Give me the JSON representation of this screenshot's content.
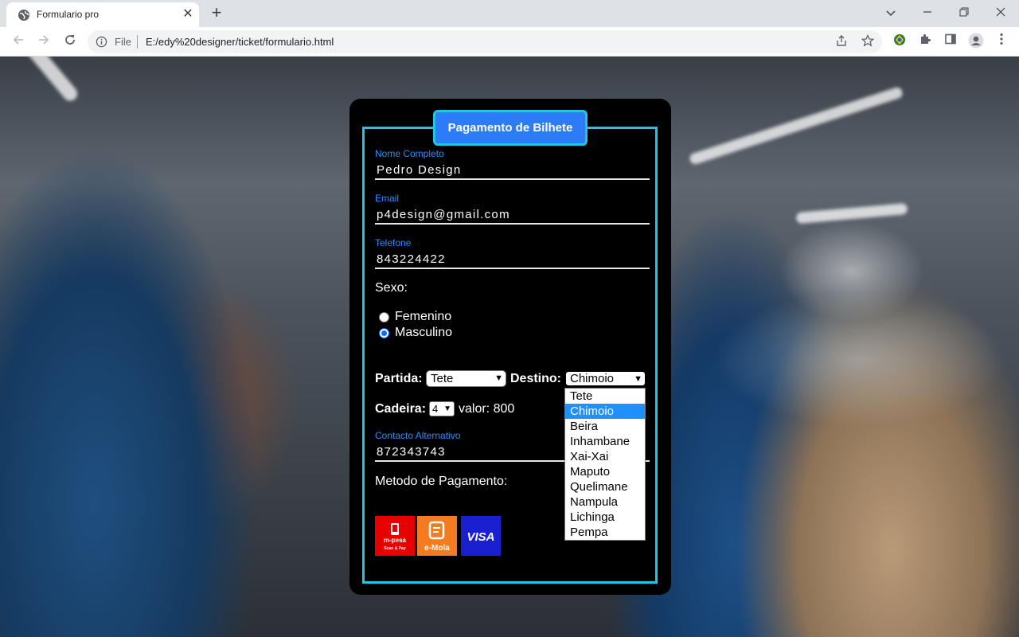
{
  "browser": {
    "tab_title": "Formulario pro",
    "tab_close": "✕",
    "new_tab": "+",
    "url_scheme": "File",
    "url": "E:/edy%20designer/ticket/formulario.html"
  },
  "form": {
    "title": "Pagamento de Bilhete",
    "nome_label": "Nome Completo",
    "nome_value": "Pedro Design",
    "email_label": "Email",
    "email_value": "p4design@gmail.com",
    "telefone_label": "Telefone",
    "telefone_value": "843224422",
    "sexo_label": "Sexo:",
    "sexo_options": [
      "Femenino",
      "Masculino"
    ],
    "sexo_selected": "Masculino",
    "partida_label": "Partida:",
    "partida_value": "Tete",
    "destino_label": "Destino:",
    "destino_value": "Chimoio",
    "destino_options": [
      "Tete",
      "Chimoio",
      "Beira",
      "Inhambane",
      "Xai-Xai",
      "Maputo",
      "Quelimane",
      "Nampula",
      "Lichinga",
      "Pempa"
    ],
    "cadeira_label": "Cadeira:",
    "cadeira_value": "4",
    "valor_text": "valor: 800",
    "contacto_label": "Contacto Alternativo",
    "contacto_value": "872343743",
    "metodo_label": "Metodo de Pagamento:",
    "payment_methods": [
      {
        "name": "m-pesa",
        "subtitle": "Scan & Pay",
        "color": "#e60000"
      },
      {
        "name": "e-Mola",
        "color": "#f47b20"
      },
      {
        "name": "VISA",
        "color": "#1a1fcf"
      }
    ]
  },
  "colors": {
    "accent": "#1fc6e8",
    "legend_bg": "#2b7cf6",
    "label": "#2b8cff",
    "dropdown_selected": "#1e90ff"
  }
}
